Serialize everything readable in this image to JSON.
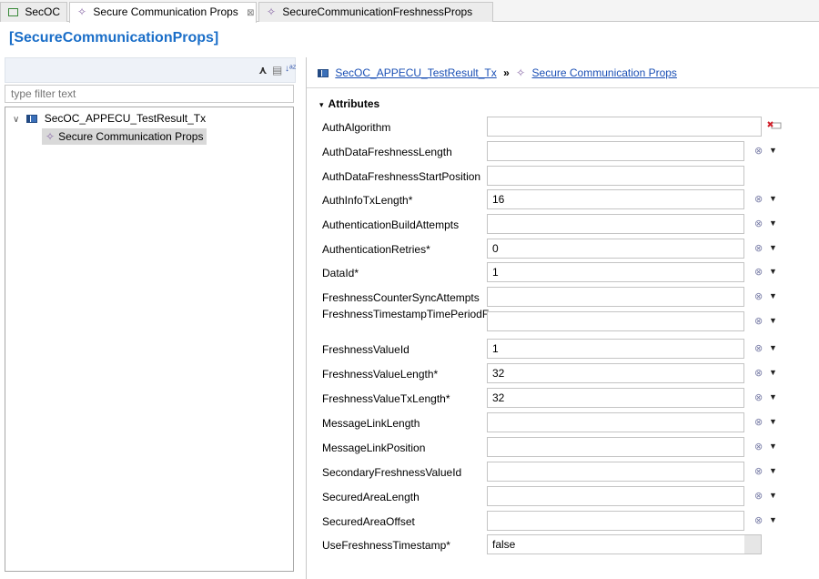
{
  "tabs": [
    {
      "label": "SecOC",
      "icon": "module-icon",
      "active": false
    },
    {
      "label": "Secure Communication Props",
      "icon": "prop-icon",
      "active": true,
      "close": "⊠"
    },
    {
      "label": "SecureCommunicationFreshnessProps",
      "icon": "prop-icon",
      "active": false
    }
  ],
  "editor_title": "[SecureCommunicationProps]",
  "left": {
    "filter_placeholder": "type filter text",
    "tree": {
      "root_label": "SecOC_APPECU_TestResult_Tx",
      "child_label": "Secure Communication Props"
    }
  },
  "breadcrumb": {
    "parent": "SecOC_APPECU_TestResult_Tx",
    "separator": "»",
    "current": "Secure Communication Props"
  },
  "section_title": "Attributes",
  "attributes": [
    {
      "label": "AuthAlgorithm",
      "value": "",
      "kind": "error"
    },
    {
      "label": "AuthDataFreshnessLength",
      "value": "",
      "kind": "ref"
    },
    {
      "label": "AuthDataFreshnessStartPosition",
      "value": "",
      "kind": "plain"
    },
    {
      "label": "AuthInfoTxLength*",
      "value": "16",
      "kind": "ref"
    },
    {
      "label": "AuthenticationBuildAttempts",
      "value": "",
      "kind": "ref"
    },
    {
      "label": "AuthenticationRetries*",
      "value": "0",
      "kind": "ref"
    },
    {
      "label": "DataId*",
      "value": "1",
      "kind": "ref"
    },
    {
      "label": "FreshnessCounterSyncAttempts",
      "value": "",
      "kind": "ref"
    },
    {
      "label": "FreshnessTimestampTimePeriodF...",
      "value": "",
      "kind": "ref"
    },
    {
      "label": "FreshnessValueId",
      "value": "1",
      "kind": "ref"
    },
    {
      "label": "FreshnessValueLength*",
      "value": "32",
      "kind": "ref"
    },
    {
      "label": "FreshnessValueTxLength*",
      "value": "32",
      "kind": "ref"
    },
    {
      "label": "MessageLinkLength",
      "value": "",
      "kind": "ref"
    },
    {
      "label": "MessageLinkPosition",
      "value": "",
      "kind": "ref"
    },
    {
      "label": "SecondaryFreshnessValueId",
      "value": "",
      "kind": "ref"
    },
    {
      "label": "SecuredAreaLength",
      "value": "",
      "kind": "ref"
    },
    {
      "label": "SecuredAreaOffset",
      "value": "",
      "kind": "ref"
    },
    {
      "label": "UseFreshnessTimestamp*",
      "value": "false",
      "kind": "readonly"
    }
  ],
  "colors": {
    "title": "#1a6ec8",
    "link": "#1a4fb5",
    "error": "#d0202b"
  }
}
